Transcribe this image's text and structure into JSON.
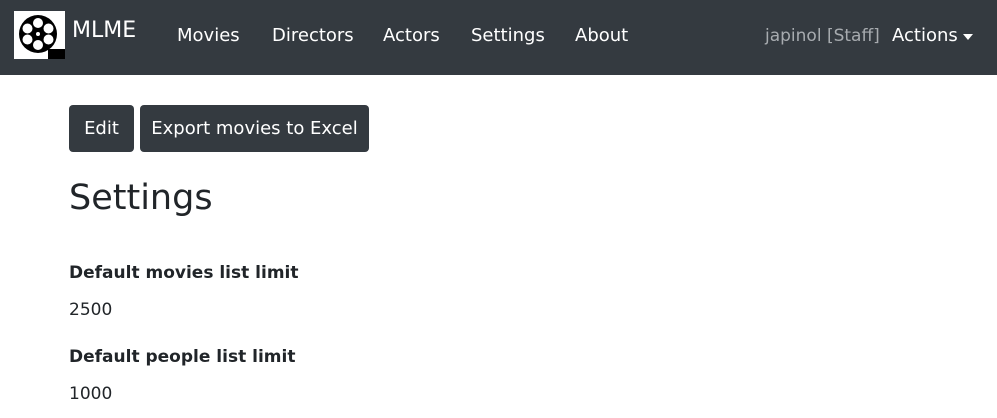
{
  "navbar": {
    "brand": "MLME",
    "links": [
      "Movies",
      "Directors",
      "Actors",
      "Settings",
      "About"
    ],
    "user": "japinol [Staff]",
    "actions_label": "Actions",
    "background": "#343a40"
  },
  "toolbar": {
    "edit_label": "Edit",
    "export_label": "Export movies to Excel"
  },
  "page": {
    "title": "Settings"
  },
  "settings": [
    {
      "label": "Default movies list limit",
      "value": "2500"
    },
    {
      "label": "Default people list limit",
      "value": "1000"
    }
  ],
  "icons": {
    "brand": "film-reel-icon",
    "actions": "caret-down-icon"
  }
}
